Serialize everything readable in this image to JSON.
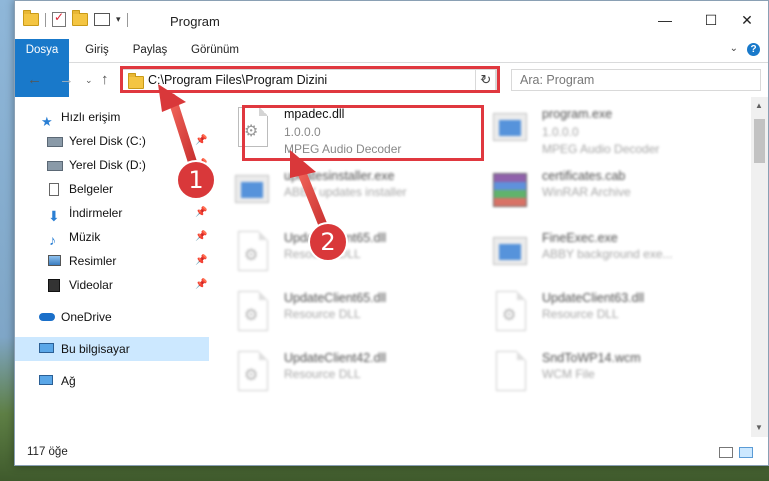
{
  "window": {
    "title": "Program"
  },
  "ribbon": {
    "tabs": [
      "Dosya",
      "Giriş",
      "Paylaş",
      "Görünüm"
    ]
  },
  "address": {
    "path": "C:\\Program Files\\Program Dizini"
  },
  "search": {
    "placeholder": "Ara: Program"
  },
  "sidebar": {
    "items": [
      {
        "label": "Hızlı erişim",
        "icon": "star-icon",
        "pinned": false
      },
      {
        "label": "Yerel Disk (C:)",
        "icon": "drive-icon",
        "pinned": true
      },
      {
        "label": "Yerel Disk (D:)",
        "icon": "drive-icon",
        "pinned": true
      },
      {
        "label": "Belgeler",
        "icon": "documents-icon",
        "pinned": true
      },
      {
        "label": "İndirmeler",
        "icon": "download-icon",
        "pinned": true
      },
      {
        "label": "Müzik",
        "icon": "music-icon",
        "pinned": true
      },
      {
        "label": "Resimler",
        "icon": "pictures-icon",
        "pinned": true
      },
      {
        "label": "Videolar",
        "icon": "video-icon",
        "pinned": true
      },
      {
        "label": "OneDrive",
        "icon": "cloud-icon",
        "pinned": false
      },
      {
        "label": "Bu bilgisayar",
        "icon": "computer-icon",
        "pinned": false
      },
      {
        "label": "Ağ",
        "icon": "network-icon",
        "pinned": false
      }
    ]
  },
  "files": [
    {
      "name": "mpadec.dll",
      "sub1": "1.0.0.0",
      "sub2": "MPEG Audio Decoder",
      "icon": "dll-icon"
    },
    {
      "name": "program.exe",
      "sub1": "1.0.0.0",
      "sub2": "MPEG Audio Decoder",
      "icon": "exe-icon"
    },
    {
      "name": "updatesinstaller.exe",
      "sub1": "ABBY updates installer",
      "sub2": "",
      "icon": "exe-icon"
    },
    {
      "name": "certificates.cab",
      "sub1": "WinRAR Archive",
      "sub2": "",
      "icon": "archive-icon"
    },
    {
      "name": "UpdateClient65.dll",
      "sub1": "Resource DLL",
      "sub2": "",
      "icon": "dll-icon"
    },
    {
      "name": "FineExec.exe",
      "sub1": "ABBY background exe...",
      "sub2": "",
      "icon": "exe-icon"
    },
    {
      "name": "UpdateClient65.dll",
      "sub1": "Resource DLL",
      "sub2": "",
      "icon": "dll-icon"
    },
    {
      "name": "UpdateClient63.dll",
      "sub1": "Resource DLL",
      "sub2": "",
      "icon": "dll-icon"
    },
    {
      "name": "UpdateClient42.dll",
      "sub1": "Resource DLL",
      "sub2": "",
      "icon": "dll-icon"
    },
    {
      "name": "SndToWP14.wcm",
      "sub1": "WCM File",
      "sub2": "",
      "icon": "dll-icon"
    }
  ],
  "status": {
    "count": "117 öğe"
  },
  "callouts": {
    "one": "1",
    "two": "2"
  },
  "colors": {
    "accent": "#1979ca",
    "highlight": "#e0383f",
    "selection": "#cce8ff"
  }
}
